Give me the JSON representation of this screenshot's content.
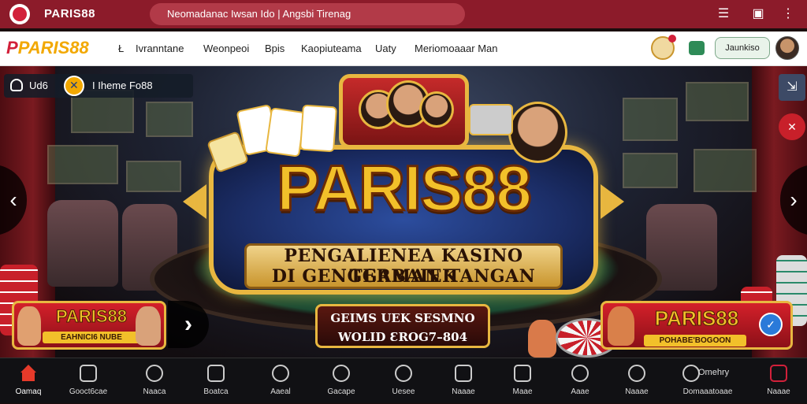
{
  "topbar": {
    "brand": "PARIS88",
    "url_text": "Neomadanac Iwsan Ido | Angsbi Tirenag",
    "icons": [
      "menu-icon",
      "tab-icon",
      "more-icon"
    ]
  },
  "navbar": {
    "logo_main": "PARIS88",
    "links": [
      {
        "label": "Ł"
      },
      {
        "label": "Ivranntane"
      },
      {
        "label": "Weonpeoi"
      },
      {
        "label": "Bpis"
      },
      {
        "label": "Kaopiuteama"
      },
      {
        "label": "Uaty"
      },
      {
        "label": "Meriomoaaar Man"
      }
    ],
    "cta_label": "Jaunkiso"
  },
  "hero": {
    "user_label": "Ud6",
    "user_tag": "I Iheme Fo88",
    "brand_title": "PARIS88",
    "subtitle_line1": "PENGALIENEA KASINO TERBAIEK",
    "subtitle_line2": "DI GENGGAMAN TANGAN",
    "center_button_line1": "GEIMS UEK SESMNO",
    "center_button_line2": "WOLID ƐROG7–804",
    "promo_left_title": "PARIS88",
    "promo_left_sub": "EAHNICI6 NUBE",
    "promo_right_title": "PARIS88",
    "promo_right_sub": "POHABE'BOGOON",
    "prev_arrow": "‹",
    "next_arrow": "›",
    "carousel_next": "›"
  },
  "bottom_nav": [
    {
      "label": "Oamaq",
      "icon": "home-icon",
      "active": true
    },
    {
      "label": "Gooct6cae",
      "icon": "cards-icon"
    },
    {
      "label": "Naaca",
      "icon": "slots-icon"
    },
    {
      "label": "Boatca",
      "icon": "grid-icon"
    },
    {
      "label": "Aaeal",
      "icon": "person-icon"
    },
    {
      "label": "Gacape",
      "icon": "chat-icon"
    },
    {
      "label": "Uesee",
      "icon": "clock-icon"
    },
    {
      "label": "Naaae",
      "icon": "clipboard-icon"
    },
    {
      "label": "Maae",
      "icon": "camera-icon"
    },
    {
      "label": "Aaae",
      "icon": "headset-icon"
    },
    {
      "label": "Naaae",
      "icon": "coin-icon"
    },
    {
      "label": "Domaaatoaae",
      "icon": "timer-icon",
      "extra": "Omehry"
    },
    {
      "label": "Naaae",
      "icon": "gift-icon"
    }
  ],
  "colors": {
    "primary": "#8c1b2a",
    "accent_gold": "#e8b740",
    "bottom_bg": "#111114"
  }
}
